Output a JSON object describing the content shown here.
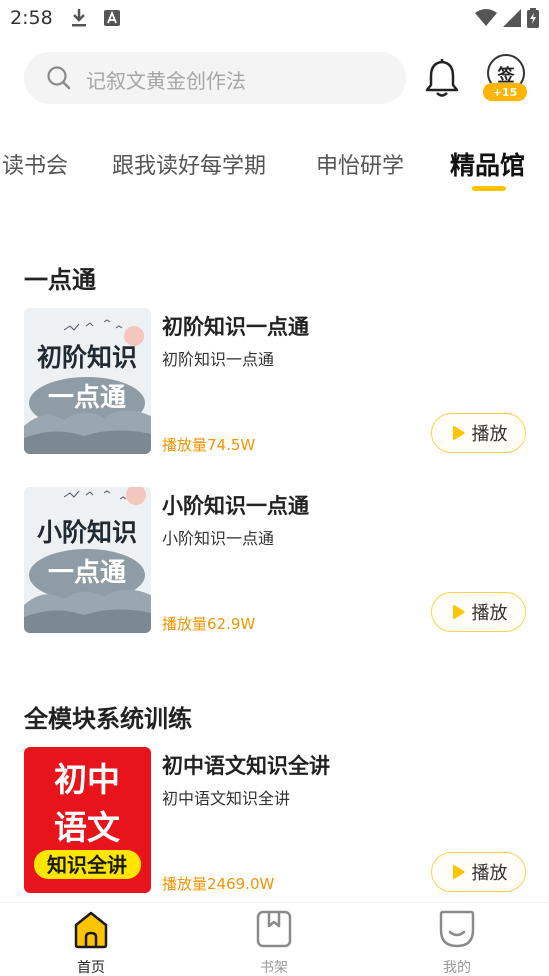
{
  "status_bar": {
    "time": "2:58"
  },
  "search": {
    "placeholder": "记叙文黄金创作法"
  },
  "signin": {
    "label": "签",
    "badge": "+15"
  },
  "tabs": [
    {
      "label": "读书会"
    },
    {
      "label": "跟我读好每学期"
    },
    {
      "label": "申怡研学"
    },
    {
      "label": "精品馆"
    }
  ],
  "sections": [
    {
      "title": "一点通",
      "courses": [
        {
          "title": "初阶知识一点通",
          "subtitle": "初阶知识一点通",
          "plays": "播放量74.5W",
          "play_label": "播放",
          "cover_line1": "初阶知识",
          "cover_line2": "一点通"
        },
        {
          "title": "小阶知识一点通",
          "subtitle": "小阶知识一点通",
          "plays": "播放量62.9W",
          "play_label": "播放",
          "cover_line1": "小阶知识",
          "cover_line2": "一点通"
        }
      ]
    },
    {
      "title": "全模块系统训练",
      "courses": [
        {
          "title": "初中语文知识全讲",
          "subtitle": "初中语文知识全讲",
          "plays": "播放量2469.0W",
          "play_label": "播放",
          "cover_line1": "初中",
          "cover_line2": "语文",
          "cover_line3": "知识全讲"
        }
      ]
    }
  ],
  "bottom_nav": [
    {
      "label": "首页",
      "icon": "home-icon",
      "active": true
    },
    {
      "label": "书架",
      "icon": "bookshelf-icon",
      "active": false
    },
    {
      "label": "我的",
      "icon": "profile-icon",
      "active": false
    }
  ],
  "colors": {
    "accent": "#ffc400",
    "plays": "#f39400",
    "red_cover": "#e8141b"
  }
}
